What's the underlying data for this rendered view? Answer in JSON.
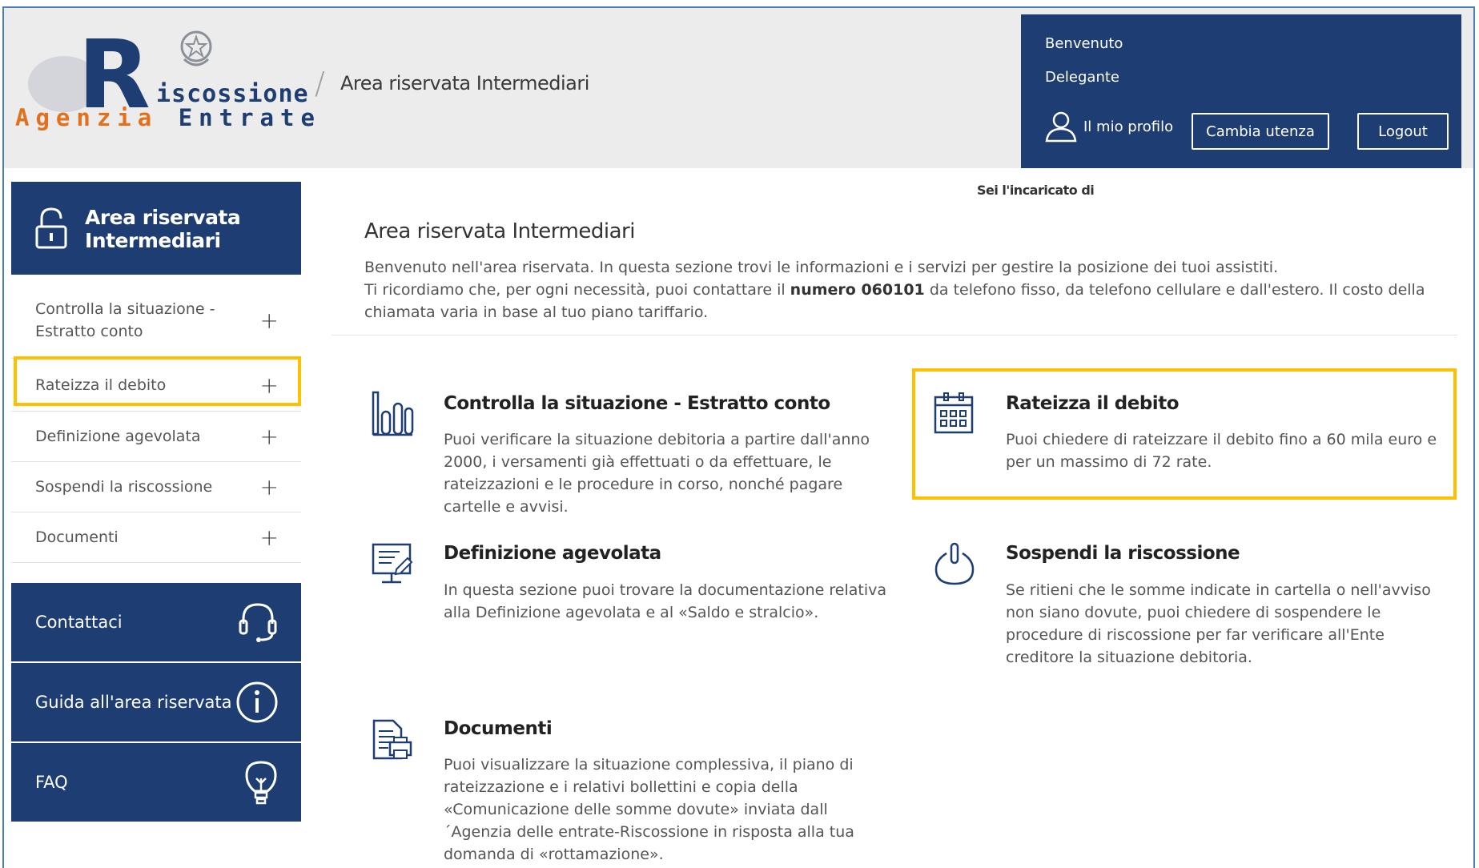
{
  "header": {
    "logo": {
      "line1": "iscossione",
      "line2a": "Agenzia",
      "line2b": "Entrate"
    },
    "breadcrumb_title": "Area riservata Intermediari",
    "user": {
      "welcome": "Benvenuto",
      "role": "Delegante",
      "profile_label": "Il mio profilo",
      "change_user_label": "Cambia utenza",
      "logout_label": "Logout"
    }
  },
  "sidebar": {
    "title_line1": "Area riservata",
    "title_line2": "Intermediari",
    "items": [
      {
        "label_line1": "Controlla la situazione -",
        "label_line2": "Estratto conto"
      },
      {
        "label": "Rateizza il debito"
      },
      {
        "label": "Definizione agevolata"
      },
      {
        "label": "Sospendi la riscossione"
      },
      {
        "label": "Documenti"
      }
    ],
    "boxes": [
      {
        "label": "Contattaci",
        "icon": "headset-icon"
      },
      {
        "label": "Guida all'area riservata",
        "icon": "info-icon"
      },
      {
        "label": "FAQ",
        "icon": "lightbulb-icon"
      }
    ]
  },
  "main": {
    "incaricato": "Sei l'incaricato di",
    "title": "Area riservata Intermediari",
    "intro_line1": "Benvenuto nell'area riservata. In questa sezione trovi le informazioni e i servizi per gestire la posizione dei tuoi assistiti.",
    "intro_line2a": "Ti ricordiamo che, per ogni necessità, puoi contattare il ",
    "intro_phone": "numero 060101",
    "intro_line2b": " da telefono fisso, da telefono cellulare e dall'estero. Il costo della chiamata varia in base al tuo piano tariffario.",
    "cards": [
      {
        "title": "Controlla la situazione - Estratto conto",
        "desc": "Puoi verificare la situazione debitoria a partire dall'anno 2000, i versamenti già effettuati o da effettuare, le rateizzazioni e le procedure in corso, nonché pagare cartelle e avvisi.",
        "icon": "chart-icon"
      },
      {
        "title": "Rateizza il debito",
        "desc": "Puoi chiedere di rateizzare il debito fino a 60 mila euro e per un massimo di 72 rate.",
        "icon": "calendar-icon"
      },
      {
        "title": "Definizione agevolata",
        "desc": "In questa sezione puoi trovare la documentazione relativa alla Definizione agevolata e al «Saldo e stralcio».",
        "icon": "monitor-edit-icon"
      },
      {
        "title": "Sospendi la riscossione",
        "desc": "Se ritieni che le somme indicate in cartella o nell'avviso non siano dovute, puoi chiedere di sospendere le procedure di riscossione per far verificare all'Ente creditore la situazione debitoria.",
        "icon": "power-icon"
      },
      {
        "title": "Documenti",
        "desc": "Puoi visualizzare la situazione complessiva, il piano di rateizzazione e i relativi bollettini e copia della «Comunicazione delle somme dovute» inviata dall´Agenzia delle entrate-Riscossione in risposta alla tua domanda di «rottamazione».",
        "icon": "document-print-icon"
      }
    ]
  },
  "colors": {
    "brand_blue": "#1d3d73",
    "brand_orange": "#e3701d",
    "highlight": "#ffc000"
  }
}
